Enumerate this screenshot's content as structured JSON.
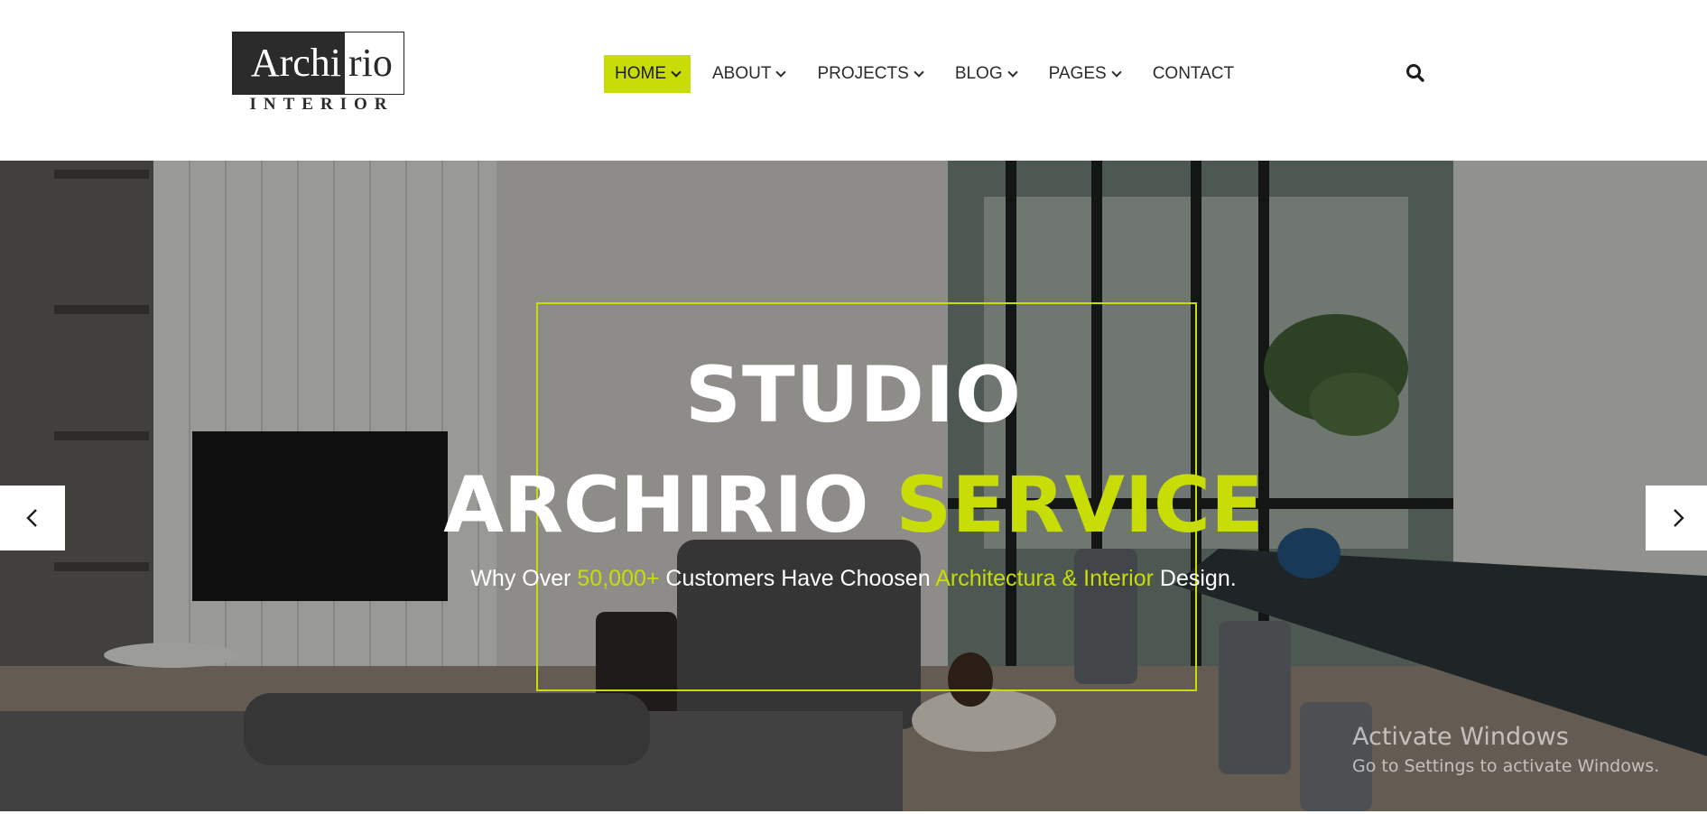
{
  "logo": {
    "word_dark": "Archi",
    "word_light": "rio",
    "sub": "INTERIOR"
  },
  "nav": {
    "items": [
      {
        "label": "HOME",
        "has_dropdown": true,
        "active": true
      },
      {
        "label": "ABOUT",
        "has_dropdown": true,
        "active": false
      },
      {
        "label": "PROJECTS",
        "has_dropdown": true,
        "active": false
      },
      {
        "label": "BLOG",
        "has_dropdown": true,
        "active": false
      },
      {
        "label": "PAGES",
        "has_dropdown": true,
        "active": false
      },
      {
        "label": "CONTACT",
        "has_dropdown": false,
        "active": false
      }
    ],
    "search_icon": "search-icon"
  },
  "hero": {
    "title_line1": "STUDIO",
    "title_line2_white": "ARCHIRIO ",
    "title_line2_accent": "SERVICE",
    "subtitle": {
      "part1": "Why Over ",
      "count": "50,000+",
      "part2": " Customers Have Choosen ",
      "highlight": "Architectura & Interior",
      "part3": " Design."
    },
    "prev_icon": "chevron-left-icon",
    "next_icon": "chevron-right-icon"
  },
  "windows_watermark": {
    "line1": "Activate Windows",
    "line2": "Go to Settings to activate Windows."
  },
  "colors": {
    "accent": "#c8dc06",
    "text_dark": "#2b2b2b",
    "white": "#ffffff"
  }
}
